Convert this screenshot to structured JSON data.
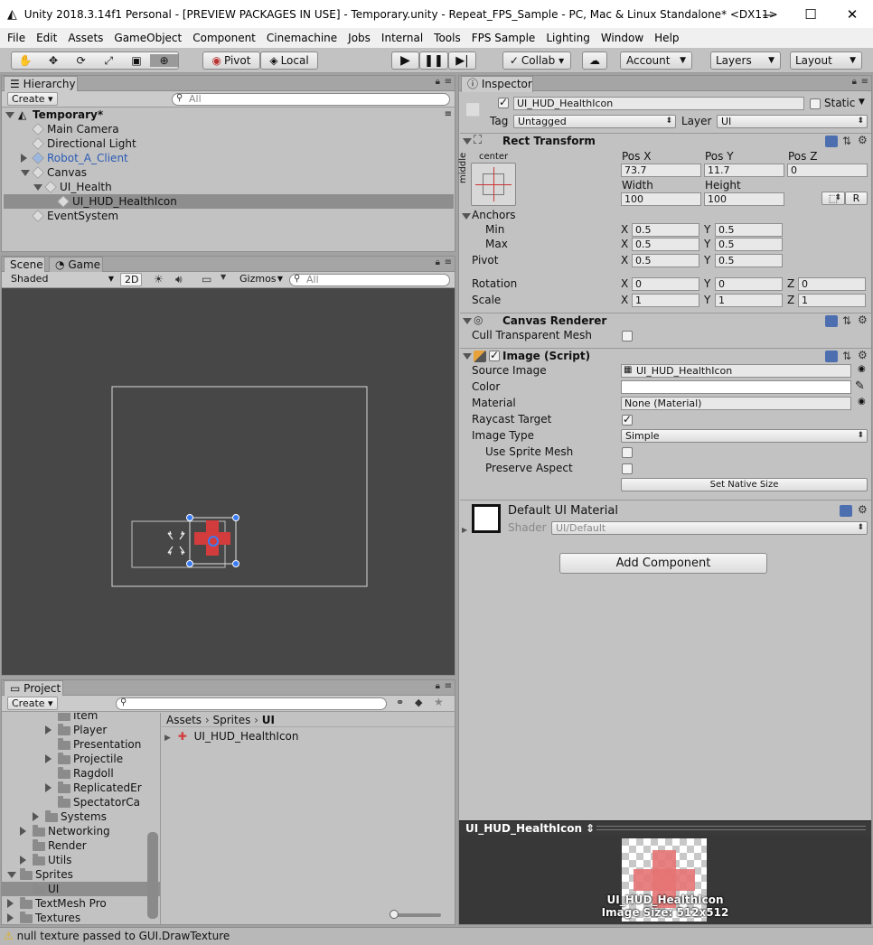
{
  "window": {
    "title": "Unity 2018.3.14f1 Personal - [PREVIEW PACKAGES IN USE] - Temporary.unity - Repeat_FPS_Sample - PC, Mac & Linux Standalone* <DX11>",
    "minimize": "—",
    "maximize": "☐",
    "close": "✕"
  },
  "menu": [
    "File",
    "Edit",
    "Assets",
    "GameObject",
    "Component",
    "Cinemachine",
    "Jobs",
    "Internal",
    "Tools",
    "FPS Sample",
    "Lighting",
    "Window",
    "Help"
  ],
  "toolbar": {
    "pivot": "Pivot",
    "local": "Local",
    "collab": "Collab ▾",
    "account": "Account",
    "layers": "Layers",
    "layout": "Layout",
    "tools": [
      "hand-icon",
      "move-icon",
      "rotate-icon",
      "scale-icon",
      "rect-icon",
      "transform-icon"
    ]
  },
  "hierarchy": {
    "tab": "Hierarchy",
    "create": "Create ▾",
    "search_placeholder": "All",
    "scene": "Temporary*",
    "items": [
      {
        "label": "Main Camera",
        "depth": 1,
        "blue": false,
        "fold": ""
      },
      {
        "label": "Directional Light",
        "depth": 1,
        "blue": false,
        "fold": ""
      },
      {
        "label": "Robot_A_Client",
        "depth": 1,
        "blue": true,
        "fold": "closed"
      },
      {
        "label": "Canvas",
        "depth": 1,
        "blue": false,
        "fold": "open"
      },
      {
        "label": "UI_Health",
        "depth": 2,
        "blue": false,
        "fold": "open"
      },
      {
        "label": "UI_HUD_HealthIcon",
        "depth": 3,
        "blue": false,
        "fold": "",
        "selected": true
      },
      {
        "label": "EventSystem",
        "depth": 1,
        "blue": false,
        "fold": ""
      }
    ]
  },
  "scene": {
    "tab_scene": "Scene",
    "tab_game": "Game",
    "shading": "Shaded",
    "mode2d": "2D",
    "gizmos": "Gizmos",
    "search_placeholder": "All"
  },
  "project": {
    "tab": "Project",
    "create": "Create ▾",
    "tree": [
      {
        "label": "Item",
        "depth": 3,
        "fold": ""
      },
      {
        "label": "Player",
        "depth": 3,
        "fold": "closed"
      },
      {
        "label": "Presentation",
        "depth": 3,
        "fold": ""
      },
      {
        "label": "Projectile",
        "depth": 3,
        "fold": "closed"
      },
      {
        "label": "Ragdoll",
        "depth": 3,
        "fold": ""
      },
      {
        "label": "ReplicatedEr",
        "depth": 3,
        "fold": "closed"
      },
      {
        "label": "SpectatorCa",
        "depth": 3,
        "fold": ""
      },
      {
        "label": "Systems",
        "depth": 2,
        "fold": "closed"
      },
      {
        "label": "Networking",
        "depth": 1,
        "fold": "closed"
      },
      {
        "label": "Render",
        "depth": 1,
        "fold": ""
      },
      {
        "label": "Utils",
        "depth": 1,
        "fold": "closed"
      },
      {
        "label": "Sprites",
        "depth": 0,
        "fold": "open"
      },
      {
        "label": "UI",
        "depth": 1,
        "fold": "",
        "selected": true
      },
      {
        "label": "TextMesh Pro",
        "depth": 0,
        "fold": "closed"
      },
      {
        "label": "Textures",
        "depth": 0,
        "fold": "closed"
      }
    ],
    "breadcrumb": [
      "Assets",
      "Sprites",
      "UI"
    ],
    "asset": "UI_HUD_HealthIcon"
  },
  "status": {
    "message": "null texture passed to GUI.DrawTexture"
  },
  "inspector": {
    "tab": "Inspector",
    "name": "UI_HUD_HealthIcon",
    "static": "Static",
    "tag_label": "Tag",
    "tag": "Untagged",
    "layer_label": "Layer",
    "layer": "UI",
    "rect": {
      "title": "Rect Transform",
      "anchor_h": "center",
      "anchor_v": "middle",
      "posx_label": "Pos X",
      "posy_label": "Pos Y",
      "posz_label": "Pos Z",
      "posx": "73.7",
      "posy": "11.7",
      "posz": "0",
      "width_label": "Width",
      "height_label": "Height",
      "width": "100",
      "height": "100",
      "r_button": "R",
      "anchors": "Anchors",
      "min": "Min",
      "max": "Max",
      "pivot": "Pivot",
      "min_x": "0.5",
      "min_y": "0.5",
      "max_x": "0.5",
      "max_y": "0.5",
      "pivot_x": "0.5",
      "pivot_y": "0.5",
      "rotation": "Rotation",
      "scale": "Scale",
      "rot_x": "0",
      "rot_y": "0",
      "rot_z": "0",
      "scale_x": "1",
      "scale_y": "1",
      "scale_z": "1",
      "x": "X",
      "y": "Y",
      "z": "Z"
    },
    "canvas_renderer": {
      "title": "Canvas Renderer",
      "cull": "Cull Transparent Mesh"
    },
    "image": {
      "title": "Image (Script)",
      "source_label": "Source Image",
      "source": "UI_HUD_HealthIcon",
      "color_label": "Color",
      "material_label": "Material",
      "material": "None (Material)",
      "raycast_label": "Raycast Target",
      "type_label": "Image Type",
      "type": "Simple",
      "sprite_mesh": "Use Sprite Mesh",
      "preserve": "Preserve Aspect",
      "native": "Set Native Size"
    },
    "material": {
      "title": "Default UI Material",
      "shader_label": "Shader",
      "shader": "UI/Default"
    },
    "add_component": "Add Component",
    "preview": {
      "title": "UI_HUD_HealthIcon ⇕",
      "name": "UI_HUD_HealthIcon",
      "size": "Image Size: 512x512"
    }
  }
}
